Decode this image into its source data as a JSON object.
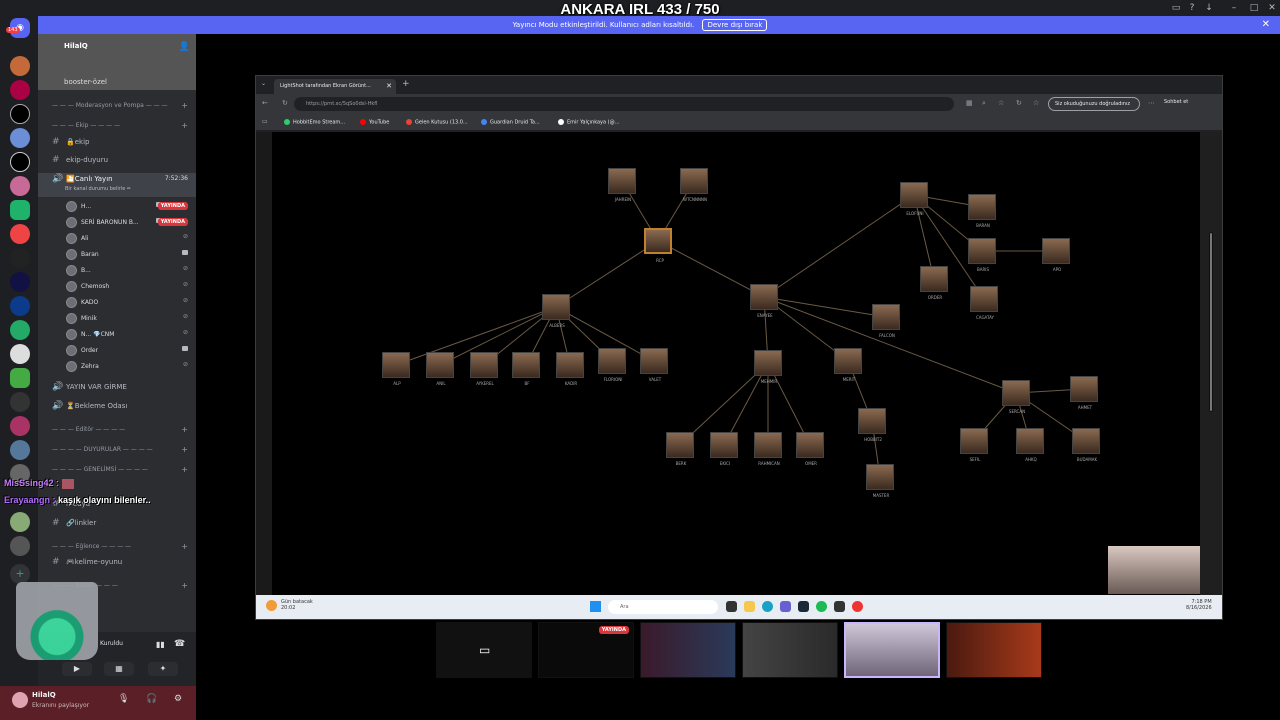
{
  "stream": {
    "title": "ANKARA IRL 433 / 750"
  },
  "banner": {
    "text": "Yayıncı Modu etkinleştirildi. Kullanıcı adları kısaltıldı.",
    "button": "Devre dışı bırak"
  },
  "rail": {
    "badge": "143"
  },
  "server": {
    "name": "HilalQ",
    "channel_header": "booster-özel"
  },
  "categories": [
    {
      "label": "— — — Moderasyon ve Pompa — — —"
    },
    {
      "label": "— — — Ekip — — — —"
    },
    {
      "label": "— — — Editör — — — —"
    },
    {
      "label": "— — — — DUYURULAR — — — —"
    },
    {
      "label": "— — — — GENELİMSİ — — — —"
    },
    {
      "label": "— — — Eğlence — — — —"
    },
    {
      "label": "— — — Sallan — — —"
    }
  ],
  "channels": {
    "ekip": "🔒ekip",
    "ekip_duyuru": "ekip-duyuru",
    "canli_yayin": "🎦Canlı Yayın",
    "canli_time": "7:52:36",
    "canli_status": "Bir kanal durumu belirle ✏",
    "yayin_var": "YAYIN VAR GİRME",
    "bekleme": "⏳Bekleme Odası",
    "medya": "medya",
    "linkler": "🔗linkler",
    "kelime": "🎮kelime-oyunu"
  },
  "voice_users": [
    {
      "name": "H...",
      "live": "YAYINDA"
    },
    {
      "name": "SERİ BARONUN B...",
      "live": "YAYINDA"
    },
    {
      "name": "Ali"
    },
    {
      "name": "Baran"
    },
    {
      "name": "B..."
    },
    {
      "name": "Chemosh"
    },
    {
      "name": "KADO"
    },
    {
      "name": "Minik"
    },
    {
      "name": "N... 💎CNM"
    },
    {
      "name": "Order"
    },
    {
      "name": "Zehra"
    }
  ],
  "chat": [
    {
      "user": "MisSsing42 :",
      "text": "",
      "color": "#c77dff"
    },
    {
      "user": "Erayaangn :",
      "text": "kaşık olayını bilenler..",
      "color": "#b36bff"
    }
  ],
  "voice_panel": {
    "status": "Kuruldu"
  },
  "user_panel": {
    "name": "HilalQ",
    "status": "Ekranını paylaşıyor"
  },
  "browser": {
    "tab_title": "LightShot tarafından Ekran Görünt...",
    "url": "https://prnt.sc/5qSo0dsl-Hkfl",
    "pill": "Siz okuduğunuzu doğruladınız",
    "copilot": "Sohbet et",
    "bookmarks": [
      "HobbitEmo Stream...",
      "YouTube",
      "Gelen Kutusu (13.0...",
      "Guardian Druid Ta...",
      "Emir Yalçınkaya (@..."
    ],
    "bookmark_colors": [
      "#2ecc71",
      "#ff0000",
      "#ea4335",
      "#4285f4",
      "#ffffff"
    ]
  },
  "graph": {
    "labels": [
      "JAHREIN",
      "WTCNNNNN",
      "ELOFUNI",
      "BARAN",
      "RCP",
      "APO",
      "BARIS",
      "ORDER",
      "CAGATAY",
      "ENAYEE",
      "FALCON",
      "ALBERS",
      "ALP",
      "ANIL",
      "AYKEREL",
      "BF",
      "KADIR",
      "FLORIONI",
      "VALET",
      "MEHMIR",
      "MERIT",
      "SERCAN",
      "AHMET",
      "HOBBIT2",
      "BERK",
      "EKICI",
      "RAHMICAN",
      "OMER",
      "MASTER",
      "SEFIL",
      "AHKQ",
      "BUDAMAK"
    ]
  },
  "taskbar": {
    "weather": "Gün batacak",
    "weather_sub": "20:02",
    "search": "Ara",
    "time": "7:18 PM",
    "date": "8/16/2026"
  },
  "thumbnails": [
    {
      "live": ""
    },
    {
      "live": "YAYINDA"
    },
    {
      "live": ""
    },
    {
      "live": ""
    },
    {
      "live": ""
    },
    {
      "live": ""
    }
  ]
}
